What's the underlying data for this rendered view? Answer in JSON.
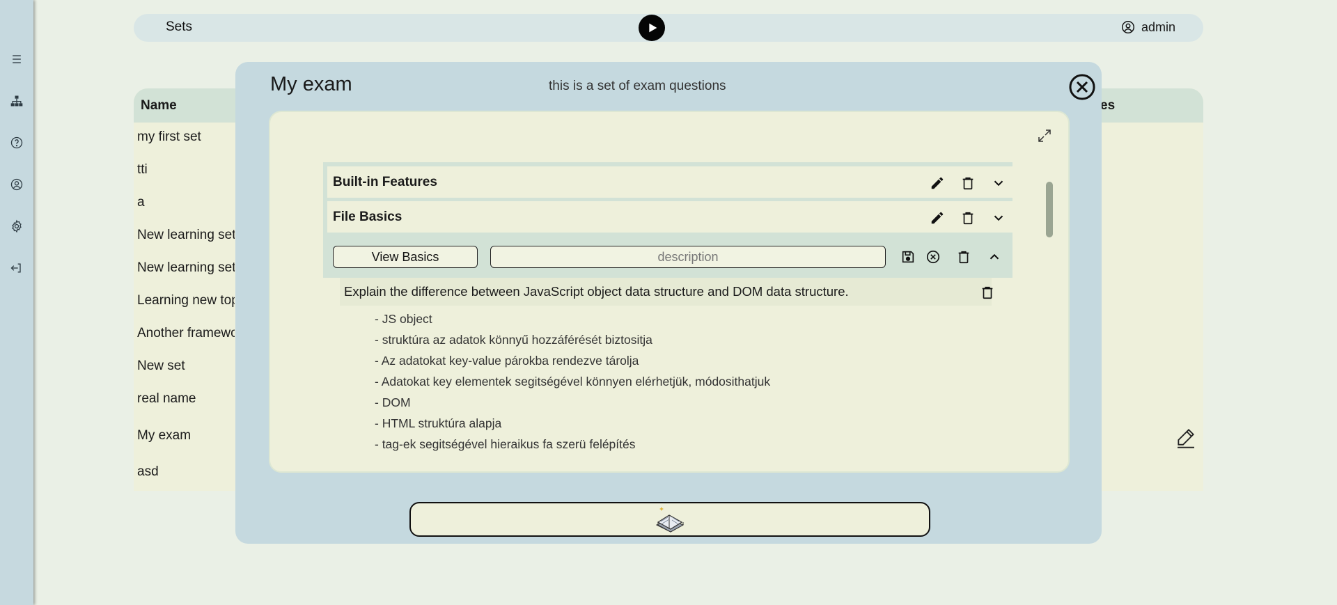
{
  "header": {
    "title": "Sets",
    "user": "admin"
  },
  "sidebar": {
    "icons": [
      "menu-icon",
      "sitemap-icon",
      "help-icon",
      "user-circle-icon",
      "gear-icon",
      "logout-icon"
    ]
  },
  "table": {
    "col_name": "Name",
    "col_right": "es",
    "rows": [
      "my first set",
      "tti",
      "a",
      "New learning set",
      "New learning set",
      "Learning new topic",
      "Another framework",
      "New set",
      "real name",
      "My exam",
      "asd"
    ]
  },
  "modal": {
    "title": "My exam",
    "description": "this is a set of exam questions",
    "topics": [
      {
        "title": "Built-in Features"
      },
      {
        "title": "File Basics"
      }
    ],
    "open_topic": {
      "title_value": "View Basics",
      "description_placeholder": "description"
    },
    "question": {
      "text": "Explain the difference between JavaScript object data structure and DOM data structure.",
      "answer_lines": [
        "- JS object",
        "- struktúra az adatok könnyű hozzáférését biztositja",
        "- Az adatokat key-value párokba rendezve tárolja",
        "- Adatokat key elementek segitségével könnyen elérhetjük, módosithatjuk",
        "- DOM",
        "- HTML struktúra alapja",
        "- tag-ek segitségével hieraikus fa szerü felépítés"
      ]
    },
    "bottom_button_icon": "study-book-icon"
  },
  "colors": {
    "background": "#eaf0e6",
    "sidebar": "#c6d9df",
    "modal": "#c5d9df",
    "panel": "#eef0db",
    "accent": "#d2e2d6"
  }
}
